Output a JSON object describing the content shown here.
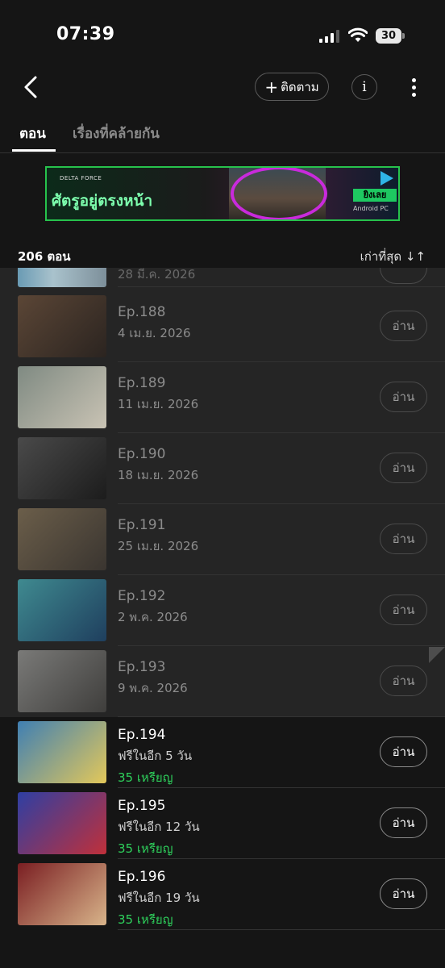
{
  "status_bar": {
    "time": "07:39",
    "battery": "30"
  },
  "nav": {
    "follow_label": "ติดตาม",
    "follow_plus": "+",
    "info_label": "i"
  },
  "tabs": [
    {
      "label": "ตอน",
      "active": true
    },
    {
      "label": "เรื่องที่คล้ายกัน",
      "active": false
    }
  ],
  "ad": {
    "brand": "DELTA FORCE",
    "headline": "ศัตรูอยู่ตรงหน้า",
    "cta": "ยิงเลย",
    "platforms": " Android  PC"
  },
  "list_header": {
    "count": "206 ตอน",
    "sort": "เก่าที่สุด ↓↑"
  },
  "partial_row": {
    "date": "28 มี.ค. 2026"
  },
  "episodes": [
    {
      "title": "Ep.188",
      "date": "4 เม.ย. 2026",
      "button": "อ่าน",
      "state": "read",
      "thumb_colors": [
        "#5b4636",
        "#2b2420"
      ]
    },
    {
      "title": "Ep.189",
      "date": "11 เม.ย. 2026",
      "button": "อ่าน",
      "state": "read",
      "thumb_colors": [
        "#7f8a82",
        "#c9c3b4"
      ]
    },
    {
      "title": "Ep.190",
      "date": "18 เม.ย. 2026",
      "button": "อ่าน",
      "state": "read",
      "thumb_colors": [
        "#4a4a4a",
        "#1c1c1c"
      ]
    },
    {
      "title": "Ep.191",
      "date": "25 เม.ย. 2026",
      "button": "อ่าน",
      "state": "read",
      "thumb_colors": [
        "#6b5e4a",
        "#3a3530"
      ]
    },
    {
      "title": "Ep.192",
      "date": "2 พ.ค. 2026",
      "button": "อ่าน",
      "state": "read",
      "thumb_colors": [
        "#3f8a90",
        "#1f3f5e"
      ]
    },
    {
      "title": "Ep.193",
      "date": "9 พ.ค. 2026",
      "button": "อ่าน",
      "state": "read",
      "thumb_colors": [
        "#7a7a78",
        "#3f3e3c"
      ]
    },
    {
      "title": "Ep.194",
      "date": "ฟรีในอีก 5 วัน",
      "price": "35 เหรียญ",
      "button": "อ่าน",
      "state": "locked",
      "thumb_colors": [
        "#3f7fb3",
        "#e3c85a"
      ]
    },
    {
      "title": "Ep.195",
      "date": "ฟรีในอีก 12 วัน",
      "price": "35 เหรียญ",
      "button": "อ่าน",
      "state": "locked",
      "thumb_colors": [
        "#2e3fa3",
        "#c0303a"
      ]
    },
    {
      "title": "Ep.196",
      "date": "ฟรีในอีก 19 วัน",
      "price": "35 เหรียญ",
      "button": "อ่าน",
      "state": "locked",
      "thumb_colors": [
        "#7a1e22",
        "#d8b48a"
      ]
    }
  ]
}
